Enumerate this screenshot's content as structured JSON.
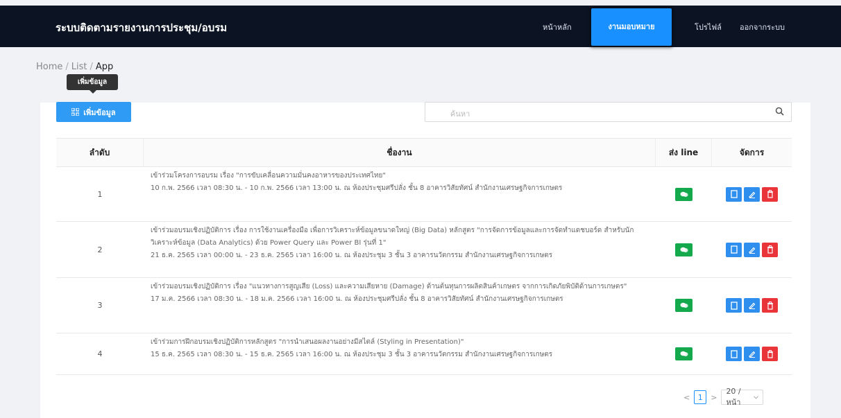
{
  "nav": {
    "brand": "ระบบติดตามรายงานการประชุม/อบรม",
    "home": "หน้าหลัก",
    "assign": "งานมอบหมาย",
    "profile": "โปรไฟล์",
    "logout": "ออกจากระบบ"
  },
  "breadcrumb": [
    "Home",
    "List",
    "App"
  ],
  "toolbar": {
    "tooltip": "เพิ่มข้อมูล",
    "add_label": "เพิ่มข้อมูล",
    "search_placeholder": "ค้นหา"
  },
  "table": {
    "headers": [
      "ลำดับ",
      "ชื่องาน",
      "ส่ง line",
      "จัดการ"
    ],
    "rows": [
      {
        "no": "1",
        "title": "เข้าร่วมโครงการอบรม เรื่อง \"การขับเคลื่อนความมั่นคงอาหารของประเทศไทย\"",
        "detail": "10 ก.พ. 2566 เวลา 08:30 น. - 10 ก.พ. 2566 เวลา 13:00 น. ณ ห้องประชุมศรีปลั่ง ชั้น 8 อาคารวิสัยทัศน์ สำนักงานเศรษฐกิจการเกษตร"
      },
      {
        "no": "2",
        "title": "เข้าร่วมอบรมเชิงปฏิบัติการ เรื่อง การใช้งานเครื่องมือ เพื่อการวิเคราะห์ข้อมูลขนาดใหญ่ (Big Data) หลักสูตร \"การจัดการข้อมูลและการจัดทำแดชบอร์ด สำหรับนักวิเคราะห์ข้อมูล (Data Analytics) ด้วย Power Query และ Power BI รุ่นที่ 1\"",
        "detail": "21 ธ.ค. 2565 เวลา 00:00 น. - 23 ธ.ค. 2565 เวลา 16:00 น. ณ ห้องประชุม 3 ชั้น 3 อาคารนวัตกรรม สำนักงานเศรษฐกิจการเกษตร"
      },
      {
        "no": "3",
        "title": "เข้าร่วมอบรมเชิงปฏิบัติการ เรื่อง \"แนวทางการสูญเสีย (Loss) และความเสียหาย (Damage) ด้านต้นทุนการผลิตสินค้าเกษตร จากการเกิดภัยพิบัติด้านการเกษตร\"",
        "detail": "17 ม.ค. 2566 เวลา 08:30 น. - 18 ม.ค. 2566 เวลา 16:00 น. ณ ห้องประชุมศรีปลั่ง ชั้น 8 อาคารวิสัยทัศน์ สำนักงานเศรษฐกิจการเกษตร"
      },
      {
        "no": "4",
        "title": "เข้าร่วมการฝึกอบรมเชิงปฏิบัติการหลักสูตร \"การนำเสนอผลงานอย่างมีสไตล์ (Styling in Presentation)\"",
        "detail": "15 ธ.ค. 2565 เวลา 08:30 น. - 15 ธ.ค. 2565 เวลา 16:00 น. ณ ห้องประชุม 3 ชั้น 3 อาคารนวัตกรรม สำนักงานเศรษฐกิจการเกษตร"
      }
    ]
  },
  "pagination": {
    "prev": "<",
    "current": "1",
    "next": ">",
    "page_size": "20 / หน้า"
  },
  "colors": {
    "navbar": "#0c1424",
    "primary": "#1890ff",
    "line_green": "#14a94d",
    "delete_red": "#e9343a"
  }
}
